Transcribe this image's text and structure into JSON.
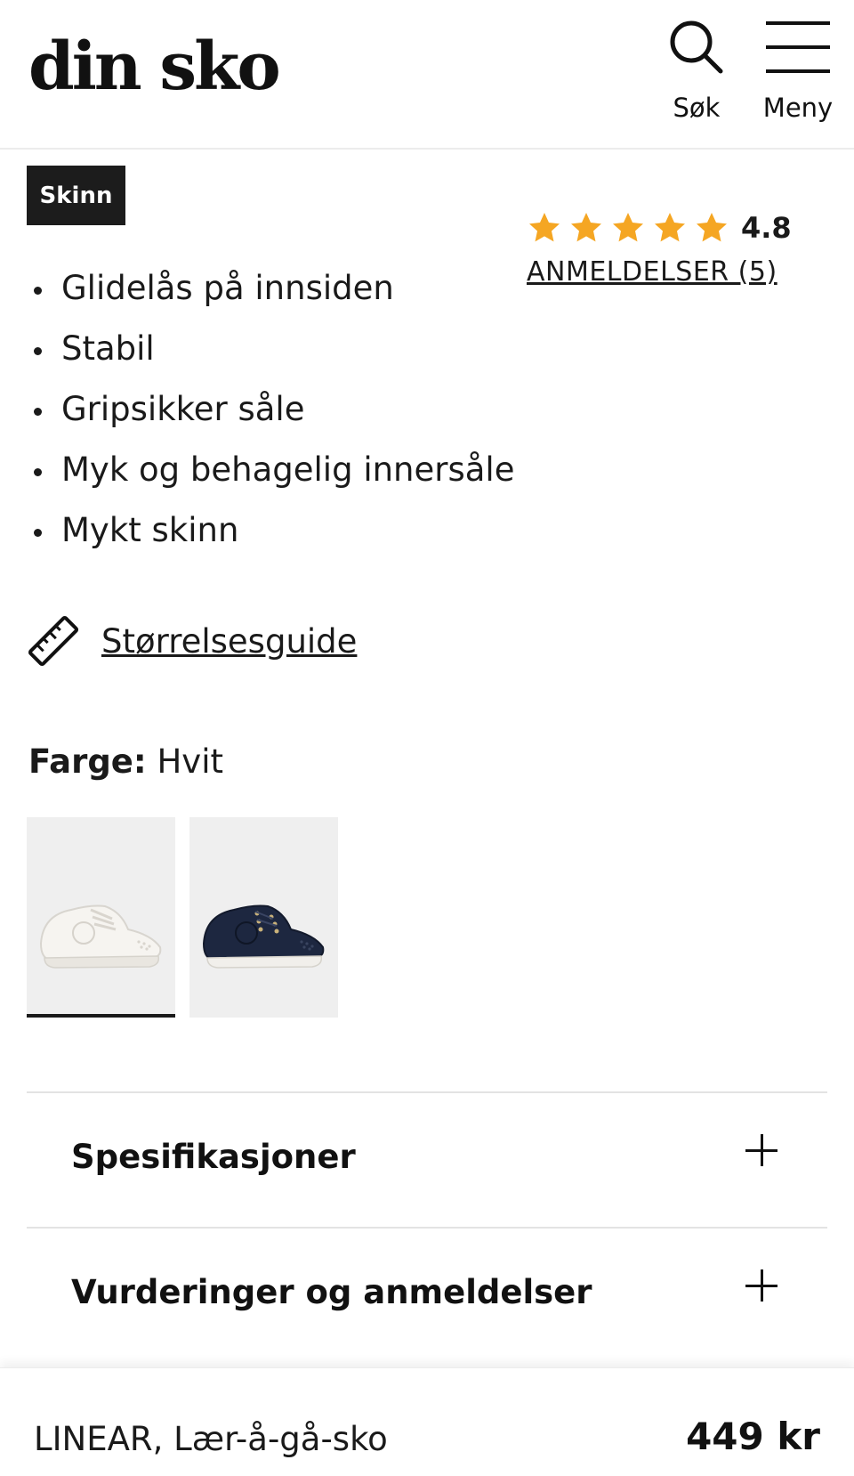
{
  "header": {
    "logo": "din sko",
    "search_label": "Søk",
    "menu_label": "Meny"
  },
  "product": {
    "badge": "Skinn",
    "rating": {
      "score": "4.8",
      "stars": 5,
      "reviews_link": "ANMELDELSER (5)"
    },
    "features": [
      "Glidelås på innsiden",
      "Stabil",
      "Gripsikker såle",
      "Myk og behagelig innersåle",
      "Mykt skinn"
    ],
    "size_guide": "Størrelsesguide",
    "color": {
      "label": "Farge:",
      "value": "Hvit"
    },
    "swatches": [
      {
        "color": "#f4f2ee",
        "selected": true
      },
      {
        "color": "#1d2740",
        "selected": false
      }
    ]
  },
  "accordions": [
    {
      "title": "Spesifikasjoner"
    },
    {
      "title": "Vurderinger og anmeldelser"
    }
  ],
  "sticky_bar": {
    "name": "LINEAR, Lær-å-gå-sko",
    "price": "449 kr"
  },
  "colors": {
    "star": "#f5a623",
    "badge_bg": "#1c1c1c",
    "text": "#1a1a1a"
  }
}
